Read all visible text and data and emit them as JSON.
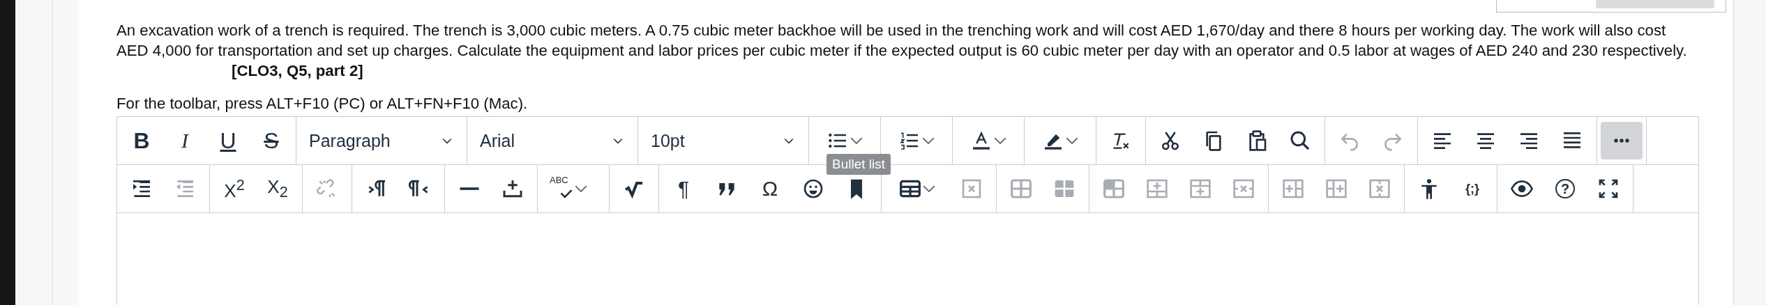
{
  "question": "An excavation work of a trench is required. The trench is 3,000 cubic meters. A 0.75 cubic meter backhoe will be used in the trenching work and will cost AED 1,670/day and there 8 hours per working day. The work will also cost AED 4,000 for transportation and set up charges. Calculate the equipment and labor prices per cubic meter if the expected output is 60 cubic meter per day with an operator and 0.5 labor at wages of AED 240 and 230 respectively.",
  "reference": "[CLO3, Q5, part 2]",
  "toolbar_hint": "For the toolbar, press ALT+F10 (PC) or ALT+FN+F10 (Mac).",
  "tooltip": "Bullet list",
  "toolbar_rows": [
    [
      {
        "kind": "buttons",
        "items": [
          {
            "kind": "bold",
            "label": "B"
          },
          {
            "kind": "italic",
            "label": "I"
          },
          {
            "kind": "underline",
            "label": "U"
          },
          {
            "kind": "strike",
            "label": "S"
          }
        ]
      },
      {
        "kind": "select",
        "value": "Paragraph"
      },
      {
        "kind": "select",
        "value": "Arial"
      },
      {
        "kind": "select",
        "value": "10pt"
      },
      {
        "kind": "buttons",
        "items": [
          {
            "kind": "bullets",
            "caret": true
          }
        ]
      },
      {
        "kind": "buttons",
        "items": [
          {
            "kind": "numbers",
            "caret": true
          }
        ]
      },
      {
        "kind": "buttons",
        "items": [
          {
            "kind": "textcolor",
            "caret": true
          }
        ]
      },
      {
        "kind": "buttons",
        "items": [
          {
            "kind": "highlight",
            "caret": true
          }
        ]
      },
      {
        "kind": "buttons",
        "items": [
          {
            "kind": "clearformat"
          }
        ]
      },
      {
        "kind": "buttons",
        "items": [
          {
            "kind": "cut"
          },
          {
            "kind": "copy"
          },
          {
            "kind": "paste"
          },
          {
            "kind": "search"
          }
        ]
      },
      {
        "kind": "buttons",
        "items": [
          {
            "kind": "undo",
            "disabled": true
          },
          {
            "kind": "redo",
            "disabled": true
          }
        ]
      },
      {
        "kind": "buttons",
        "items": [
          {
            "kind": "alignleft"
          },
          {
            "kind": "aligncenter"
          },
          {
            "kind": "alignright"
          },
          {
            "kind": "justify"
          }
        ]
      },
      {
        "kind": "buttons",
        "items": [
          {
            "kind": "more",
            "selected": true
          }
        ]
      }
    ],
    [
      {
        "kind": "buttons",
        "items": [
          {
            "kind": "indent"
          },
          {
            "kind": "outdent",
            "disabled": true
          }
        ]
      },
      {
        "kind": "buttons",
        "items": [
          {
            "kind": "sup",
            "label": "X$^{2}$"
          },
          {
            "kind": "sub",
            "label": "X$_{2}$"
          }
        ]
      },
      {
        "kind": "buttons",
        "items": [
          {
            "kind": "unlink",
            "disabled": true
          }
        ]
      },
      {
        "kind": "buttons",
        "items": [
          {
            "kind": "ltr"
          },
          {
            "kind": "rtl"
          }
        ]
      },
      {
        "kind": "buttons",
        "items": [
          {
            "kind": "hr"
          },
          {
            "kind": "insertline"
          }
        ]
      },
      {
        "kind": "buttons",
        "items": [
          {
            "kind": "spell",
            "label": "ABC",
            "caret": true
          }
        ]
      },
      {
        "kind": "buttons",
        "items": [
          {
            "kind": "sqrt"
          }
        ]
      },
      {
        "kind": "buttons",
        "items": [
          {
            "kind": "pilcrow",
            "label": "¶"
          },
          {
            "kind": "quote"
          },
          {
            "kind": "omega",
            "label": "Ω"
          },
          {
            "kind": "emoji"
          },
          {
            "kind": "bookmark"
          }
        ]
      },
      {
        "kind": "buttons",
        "items": [
          {
            "kind": "table",
            "caret": true
          },
          {
            "kind": "deltable",
            "disabled": true
          }
        ]
      },
      {
        "kind": "buttons",
        "items": [
          {
            "kind": "tablecells",
            "disabled": true
          },
          {
            "kind": "tablerows",
            "disabled": true
          }
        ]
      },
      {
        "kind": "buttons",
        "items": [
          {
            "kind": "tablecell",
            "disabled": true
          },
          {
            "kind": "rowabove",
            "disabled": true
          },
          {
            "kind": "rowbelow",
            "disabled": true
          },
          {
            "kind": "delrow",
            "disabled": true
          }
        ]
      },
      {
        "kind": "buttons",
        "items": [
          {
            "kind": "colbefore",
            "disabled": true
          },
          {
            "kind": "colafter",
            "disabled": true
          },
          {
            "kind": "delcol",
            "disabled": true
          }
        ]
      },
      {
        "kind": "buttons",
        "items": [
          {
            "kind": "accessibility"
          },
          {
            "kind": "code",
            "label": "{;}"
          }
        ]
      },
      {
        "kind": "buttons",
        "items": [
          {
            "kind": "preview"
          },
          {
            "kind": "help",
            "label": "?"
          },
          {
            "kind": "fullscreen"
          }
        ]
      }
    ]
  ]
}
